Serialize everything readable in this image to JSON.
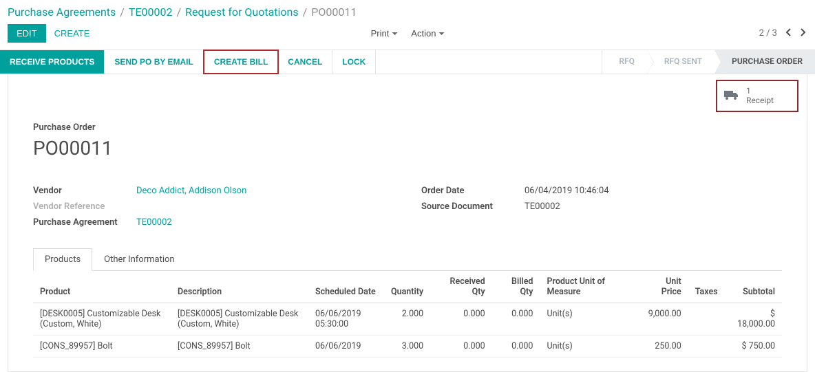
{
  "breadcrumb": {
    "items": [
      "Purchase Agreements",
      "TE00002",
      "Request for Quotations"
    ],
    "current": "PO00011"
  },
  "controls": {
    "edit": "EDIT",
    "create": "CREATE",
    "print": "Print",
    "action": "Action",
    "pager": "2 / 3"
  },
  "statusbar": {
    "buttons": {
      "receive": "RECEIVE PRODUCTS",
      "send_po": "SEND PO BY EMAIL",
      "create_bill": "CREATE BILL",
      "cancel": "CANCEL",
      "lock": "LOCK"
    },
    "steps": {
      "rfq": "RFQ",
      "rfq_sent": "RFQ SENT",
      "po": "PURCHASE ORDER"
    }
  },
  "receipt_box": {
    "count": "1",
    "label": "Receipt"
  },
  "form": {
    "title_label": "Purchase Order",
    "title_value": "PO00011",
    "left": {
      "vendor_label": "Vendor",
      "vendor_value": "Deco Addict, Addison Olson",
      "vendor_ref_label": "Vendor Reference",
      "vendor_ref_value": "",
      "pa_label": "Purchase Agreement",
      "pa_value": "TE00002"
    },
    "right": {
      "order_date_label": "Order Date",
      "order_date_value": "06/04/2019 10:46:04",
      "source_doc_label": "Source Document",
      "source_doc_value": "TE00002"
    }
  },
  "tabs": {
    "products": "Products",
    "other": "Other Information"
  },
  "table": {
    "headers": {
      "product": "Product",
      "description": "Description",
      "scheduled_date": "Scheduled Date",
      "quantity": "Quantity",
      "received_qty": "Received Qty",
      "billed_qty": "Billed Qty",
      "uom": "Product Unit of Measure",
      "unit_price": "Unit Price",
      "taxes": "Taxes",
      "subtotal": "Subtotal"
    },
    "rows": [
      {
        "product": "[DESK0005] Customizable Desk (Custom, White)",
        "description": "[DESK0005] Customizable Desk (Custom, White)",
        "scheduled_date": "06/06/2019 05:30:00",
        "quantity": "2.000",
        "received_qty": "0.000",
        "billed_qty": "0.000",
        "uom": "Unit(s)",
        "unit_price": "9,000.00",
        "taxes": "",
        "subtotal": "$ 18,000.00"
      },
      {
        "product": "[CONS_89957] Bolt",
        "description": "[CONS_89957] Bolt",
        "scheduled_date": "06/06/2019",
        "quantity": "3.000",
        "received_qty": "0.000",
        "billed_qty": "0.000",
        "uom": "Unit(s)",
        "unit_price": "250.00",
        "taxes": "",
        "subtotal": "$ 750.00"
      }
    ]
  }
}
